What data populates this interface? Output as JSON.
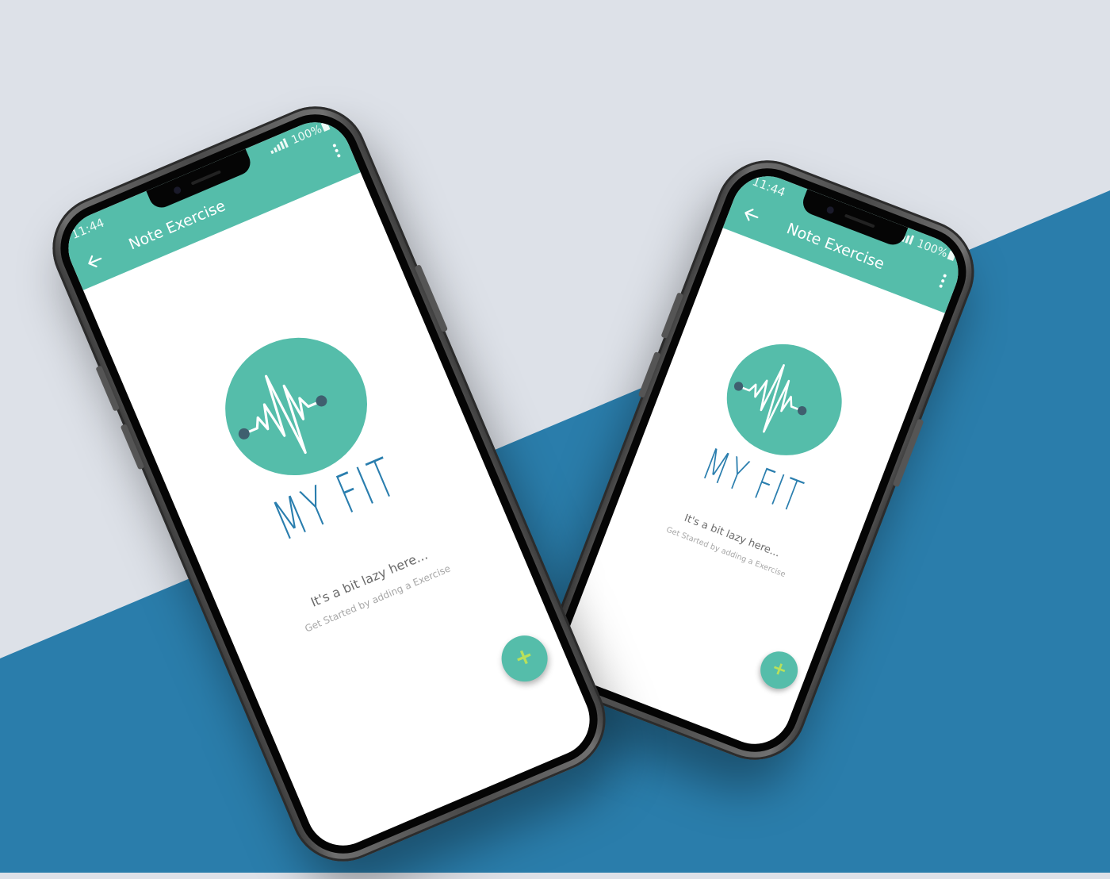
{
  "colors": {
    "appbar": "#55bdaa",
    "accent": "#55bdaa",
    "brand_text": "#2a7eae",
    "bg_light": "#dde1e8",
    "bg_blue": "#2a7dab",
    "fab_plus": "#b9e05a"
  },
  "phones": [
    {
      "status": {
        "time": "11:44",
        "battery": "100%"
      },
      "appbar": {
        "title": "Note Exercise",
        "back_icon": "arrow-left-icon",
        "menu_icon": "more-vertical-icon"
      },
      "logo": {
        "brand": "MY FIT",
        "icon": "heartbeat-dumbbell-icon"
      },
      "empty_state": {
        "title": "It's a bit lazy here...",
        "subtitle": "Get Started by adding a Exercise"
      },
      "fab": {
        "label": "+",
        "icon": "plus-icon"
      }
    },
    {
      "status": {
        "time": "11:44",
        "battery": "100%"
      },
      "appbar": {
        "title": "Note Exercise",
        "back_icon": "arrow-left-icon",
        "menu_icon": "more-vertical-icon"
      },
      "logo": {
        "brand": "MY FIT",
        "icon": "heartbeat-dumbbell-icon"
      },
      "empty_state": {
        "title": "It's a bit lazy here...",
        "subtitle": "Get Started by adding a Exercise"
      },
      "fab": {
        "label": "+",
        "icon": "plus-icon"
      }
    }
  ]
}
